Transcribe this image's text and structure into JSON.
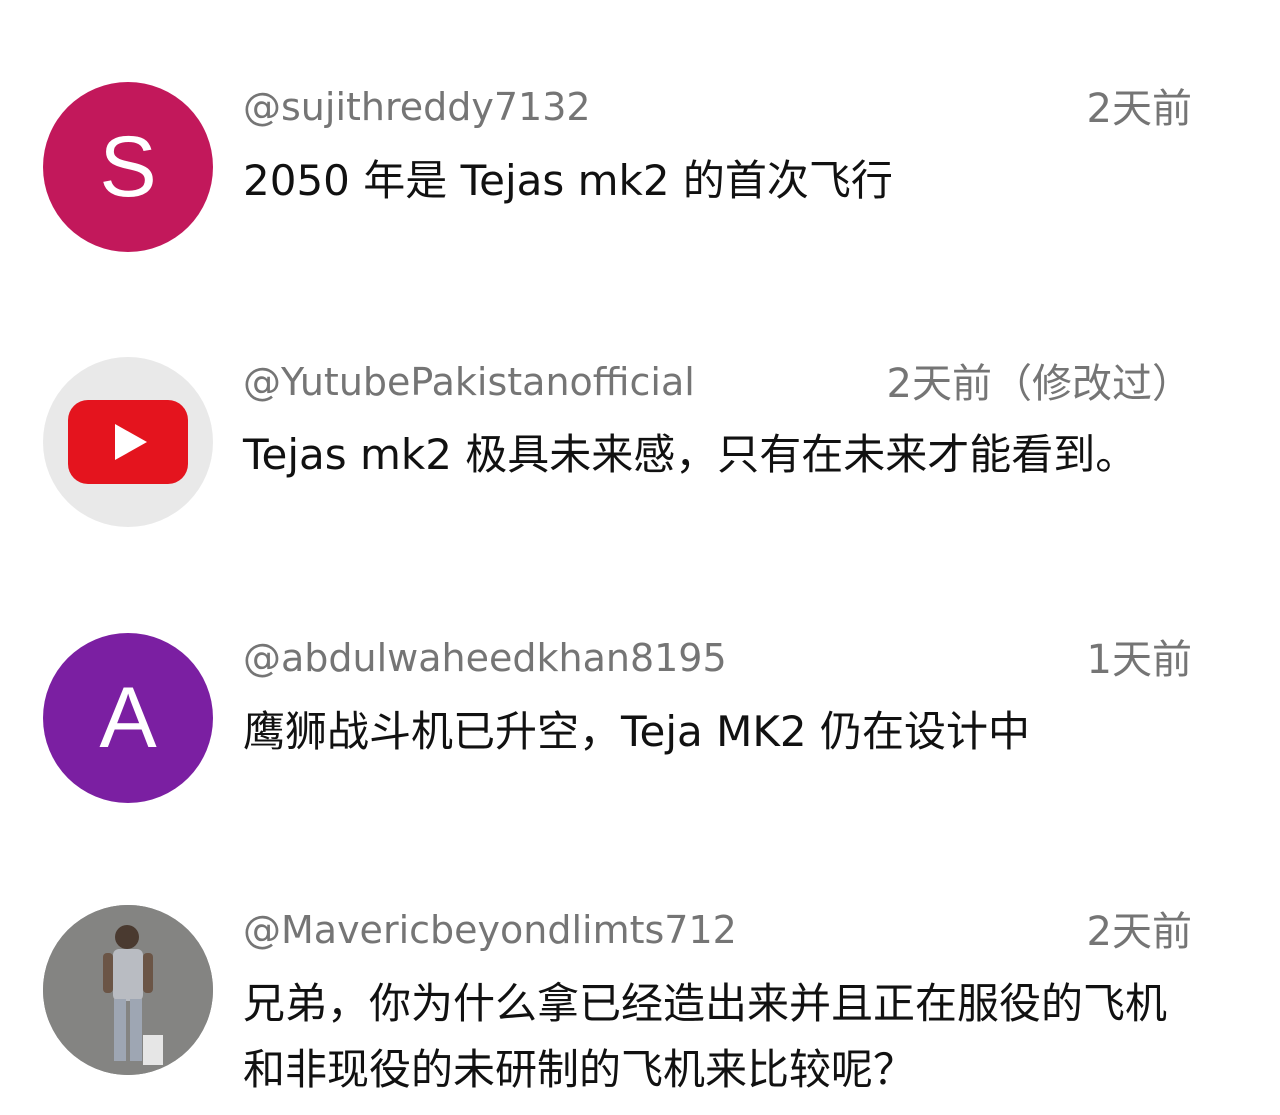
{
  "comments": [
    {
      "avatar_letter": "S",
      "avatar_color": "#c2185b",
      "handle": "@sujithreddy7132",
      "time": "2天前",
      "text": "2050 年是 Tejas mk2 的首次飞行"
    },
    {
      "avatar_icon": "youtube-logo-icon",
      "avatar_bg": "#e9e9e9",
      "logo_color": "#e4141e",
      "handle": "@YutubePakistanofficial",
      "time": "2天前（修改过）",
      "text": "Tejas mk2 极具未来感，只有在未来才能看到。"
    },
    {
      "avatar_letter": "A",
      "avatar_color": "#7b1fa2",
      "handle": "@abdulwaheedkhan8195",
      "time": "1天前",
      "text": "鹰狮战斗机已升空，Teja MK2 仍在设计中"
    },
    {
      "avatar_icon": "person-photo-avatar",
      "avatar_bg": "#8c8c8c",
      "handle": "@Mavericbeyondlimts712",
      "time": "2天前",
      "text": "兄弟，你为什么拿已经造出来并且正在服役的飞机和非现役的未研制的飞机来比较呢？"
    }
  ]
}
